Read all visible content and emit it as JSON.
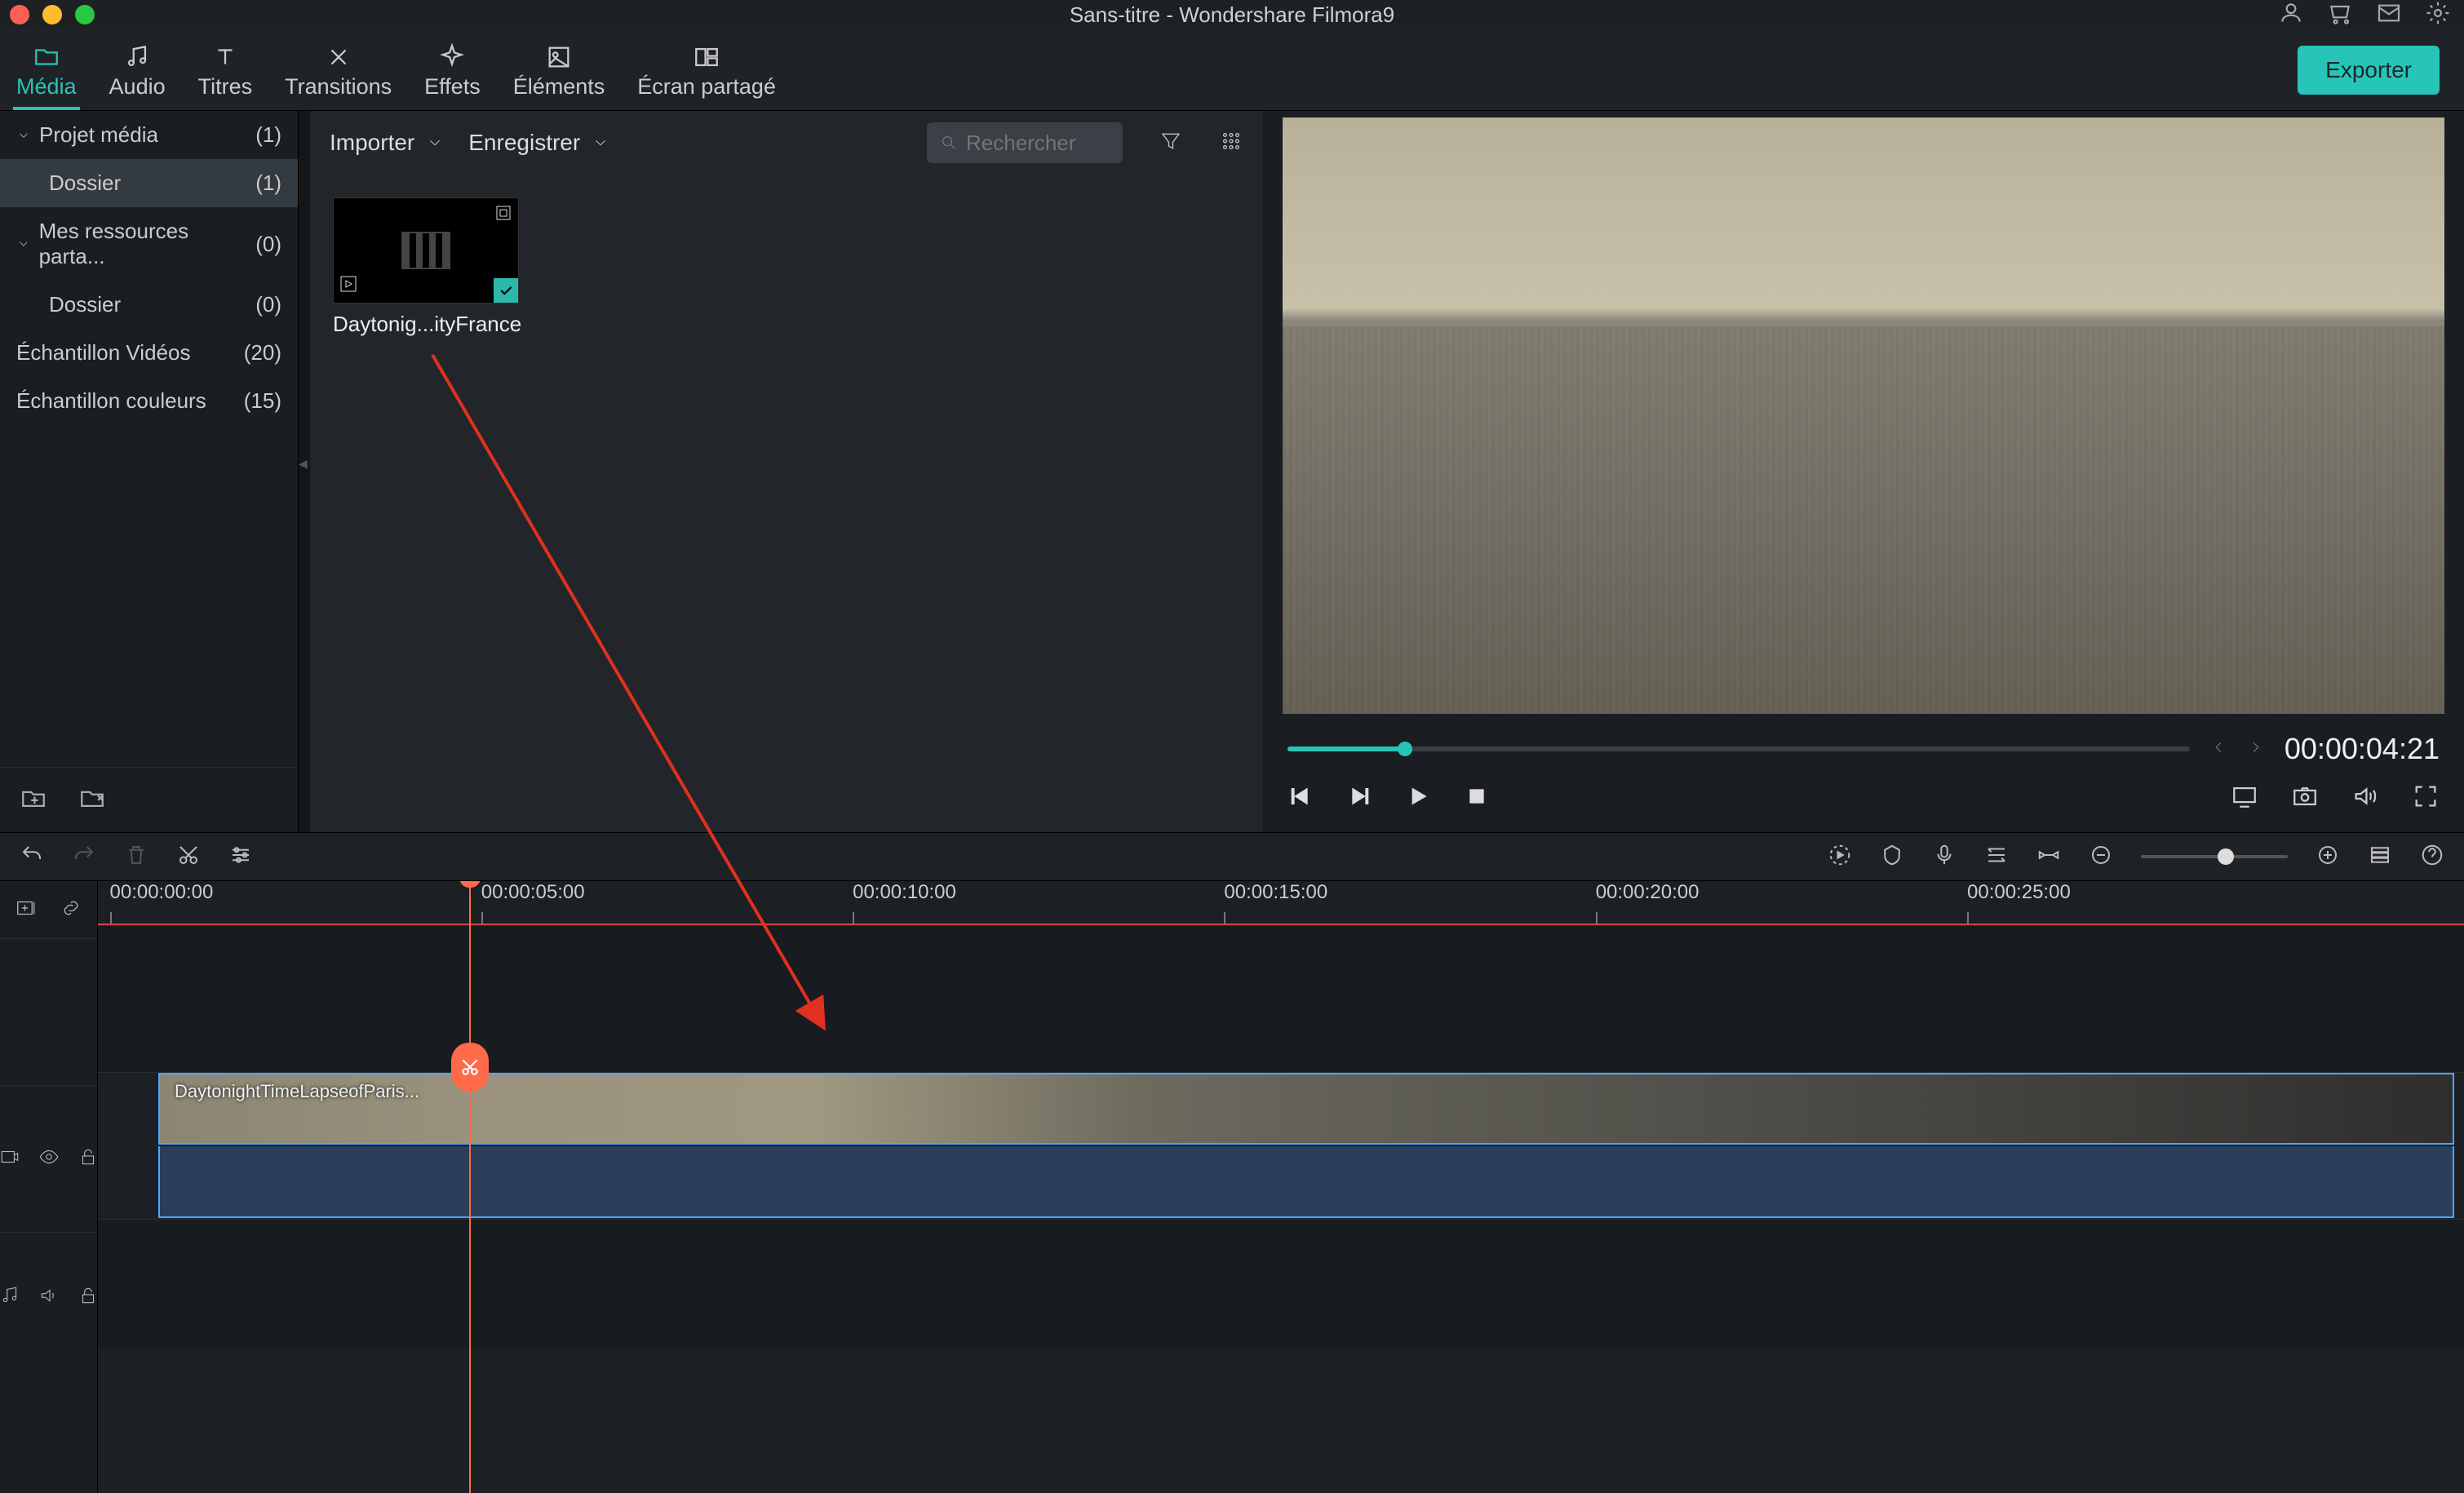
{
  "window": {
    "title": "Sans-titre - Wondershare Filmora9"
  },
  "tabs": {
    "media": "Média",
    "audio": "Audio",
    "titres": "Titres",
    "transitions": "Transitions",
    "effets": "Effets",
    "elements": "Éléments",
    "ecran": "Écran partagé",
    "export": "Exporter"
  },
  "sidebar": {
    "items": [
      {
        "label": "Projet média",
        "count": "(1)",
        "expandable": true
      },
      {
        "label": "Dossier",
        "count": "(1)",
        "sub": true,
        "selected": true
      },
      {
        "label": "Mes ressources parta...",
        "count": "(0)",
        "expandable": true
      },
      {
        "label": "Dossier",
        "count": "(0)",
        "sub": true
      },
      {
        "label": "Échantillon Vidéos",
        "count": "(20)"
      },
      {
        "label": "Échantillon couleurs",
        "count": "(15)"
      }
    ]
  },
  "mediabar": {
    "import": "Importer",
    "record": "Enregistrer",
    "search_ph": "Rechercher"
  },
  "thumb": {
    "name": "Daytonig...ityFrance"
  },
  "preview": {
    "timecode": "00:00:04:21"
  },
  "ruler": {
    "marks": [
      {
        "label": "00:00:00:00",
        "pct": 0.5
      },
      {
        "label": "00:00:05:00",
        "pct": 16.2
      },
      {
        "label": "00:00:10:00",
        "pct": 31.9
      },
      {
        "label": "00:00:15:00",
        "pct": 47.6
      },
      {
        "label": "00:00:20:00",
        "pct": 63.3
      },
      {
        "label": "00:00:25:00",
        "pct": 79.0
      }
    ]
  },
  "clip": {
    "label": "DaytonightTimeLapseofParis..."
  }
}
